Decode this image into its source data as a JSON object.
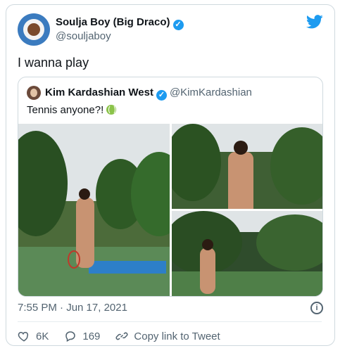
{
  "author": {
    "name": "Soulja Boy (Big Draco)",
    "handle": "@souljaboy"
  },
  "tweet": {
    "text": "I wanna play",
    "time": "7:55 PM · Jun 17, 2021"
  },
  "quoted": {
    "name": "Kim Kardashian West",
    "handle": "@KimKardashian",
    "text": "Tennis anyone?!"
  },
  "actions": {
    "likes": "6K",
    "replies": "169",
    "copy_link": "Copy link to Tweet"
  },
  "colors": {
    "twitter_blue": "#1d9bf0",
    "muted": "#536471"
  }
}
